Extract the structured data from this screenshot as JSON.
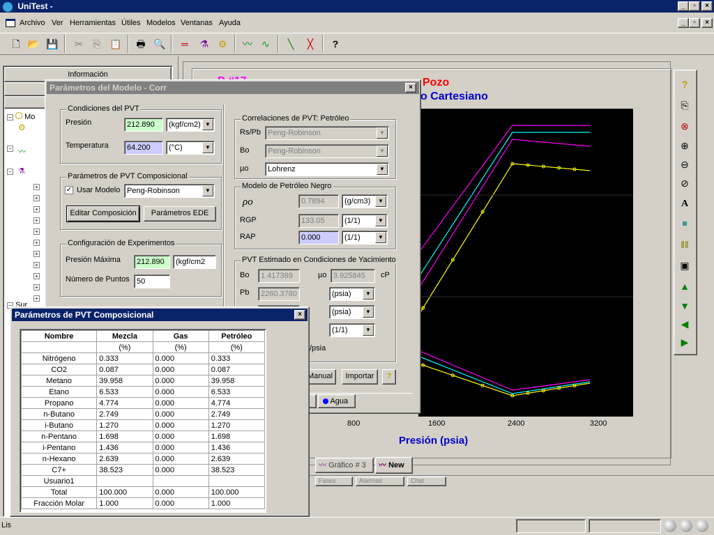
{
  "app": {
    "title": "UniTest -"
  },
  "menu": [
    "Archivo",
    "Ver",
    "Herramientas",
    "Útiles",
    "Modelos",
    "Ventanas",
    "Ayuda"
  ],
  "left_panel": {
    "header": "Información",
    "tree_items": [
      "Mo",
      "Sur"
    ]
  },
  "chart": {
    "title_red": "Pozo",
    "title_red_prefix": "P #17",
    "title_blue": "o Cartesiano",
    "xlabel": "Presión (psia)",
    "tabs": [
      "Gráfico # 3",
      "New"
    ],
    "bottom_tabs": [
      "Fases",
      "Alarmas",
      "Chat"
    ],
    "side_icons": [
      "help-icon",
      "copy-icon",
      "zoom-fit-icon",
      "zoom-in-icon",
      "zoom-out-icon",
      "zoom-reset-icon",
      "text-icon",
      "legend-icon",
      "grid-icon",
      "properties-icon",
      "arrow-up-icon",
      "arrow-down-icon",
      "arrow-left-icon",
      "arrow-right-icon"
    ]
  },
  "chart_data": {
    "type": "line",
    "x_ticks": [
      "800",
      "1600",
      "2400",
      "3200"
    ],
    "xlabel": "Presión (psia)",
    "series": [
      {
        "color": "#ff00ff",
        "points": [
          [
            960,
            470
          ],
          [
            2300,
            180
          ],
          [
            3000,
            180
          ]
        ]
      },
      {
        "color": "#00ffff",
        "points": [
          [
            960,
            520
          ],
          [
            2300,
            190
          ],
          [
            3000,
            190
          ]
        ]
      },
      {
        "color": "#ff00ff",
        "points": [
          [
            960,
            540
          ],
          [
            2300,
            200
          ],
          [
            3000,
            210
          ]
        ]
      },
      {
        "color": "#ffff00",
        "points": [
          [
            960,
            580
          ],
          [
            2300,
            235
          ],
          [
            3000,
            245
          ]
        ]
      }
    ],
    "series_lower": [
      {
        "color": "#ff00ff",
        "points": [
          [
            960,
            470
          ],
          [
            2300,
            560
          ],
          [
            3000,
            545
          ]
        ]
      },
      {
        "color": "#00ffff",
        "points": [
          [
            960,
            480
          ],
          [
            2300,
            565
          ],
          [
            3000,
            548
          ]
        ]
      },
      {
        "color": "#ffff00",
        "points": [
          [
            960,
            495
          ],
          [
            2300,
            568
          ],
          [
            3000,
            550
          ]
        ]
      }
    ],
    "xlim": [
      700,
      3400
    ]
  },
  "dialog_modelo": {
    "title": "Parámetros del Modelo - Corr",
    "condiciones": {
      "title": "Condiciones del PVT",
      "presion_label": "Presión",
      "presion_value": "212.890",
      "presion_unit": "(kgf/cm2)",
      "temperatura_label": "Temperatura",
      "temperatura_value": "64.200",
      "temperatura_unit": "(°C)"
    },
    "composicional": {
      "title": "Parámetros de PVT Composicional",
      "usar_modelo_label": "Usar Modelo",
      "usar_modelo_value": "Peng-Robinson",
      "editar_btn": "Editar Composición",
      "ede_btn": "Parámetros EDE"
    },
    "experimentos": {
      "title": "Configuración de Experimentos",
      "presion_max_label": "Presión Máxima",
      "presion_max_value": "212.890",
      "presion_max_unit": "(kgf/cm2",
      "num_puntos_label": "Número de Puntos",
      "num_puntos_value": "50"
    },
    "correlaciones": {
      "title": "Correlaciones de PVT: Petróleo",
      "rspb_label": "Rs/Pb",
      "rspb_value": "Peng-Robinson",
      "bo_label": "Bo",
      "bo_value": "Peng-Robinson",
      "muo_label": "µo",
      "muo_value": "Lohrenz"
    },
    "petroleo_negro": {
      "title": "Modelo de Petróleo Negro",
      "rho_label": "ρo",
      "rho_value": "0.7894",
      "rho_unit": "(g/cm3)",
      "rgp_label": "RGP",
      "rgp_value": "133.05",
      "rgp_unit": "(1/1)",
      "rap_label": "RAP",
      "rap_value": "0.000",
      "rap_unit": "(1/1)"
    },
    "estimado": {
      "title": "PVT Estimado en Condiciones de Yacimiento",
      "bo_label": "Bo",
      "bo_value": "1.417389",
      "mu_label": "µo",
      "mu_value": "3.925845",
      "mu_unit": "cP",
      "pb_label": "Pb",
      "pb_value": "2260.3780",
      "pb_unit": "(psia)",
      "row2_unit": "(psia)",
      "row3_unit": "(1/1)",
      "row4_fragment": "/psia"
    },
    "buttons": {
      "manual": "Manual",
      "importar": "Importar",
      "help": "?"
    },
    "tabs": {
      "agua": "Agua"
    }
  },
  "dialog_composicional": {
    "title": "Parámetros de PVT Composicional",
    "columns": [
      "Nombre",
      "Mezcla",
      "Gas",
      "Petróleo"
    ],
    "units": [
      "",
      "(%)",
      "(%)",
      "(%)"
    ],
    "rows": [
      [
        "Nitrógeno",
        "0.333",
        "0.000",
        "0.333"
      ],
      [
        "CO2",
        "0.087",
        "0.000",
        "0.087"
      ],
      [
        "Metano",
        "39.958",
        "0.000",
        "39.958"
      ],
      [
        "Etano",
        "6.533",
        "0.000",
        "6.533"
      ],
      [
        "Propano",
        "4.774",
        "0.000",
        "4.774"
      ],
      [
        "n-Butano",
        "2.749",
        "0.000",
        "2.749"
      ],
      [
        "i-Butano",
        "1.270",
        "0.000",
        "1.270"
      ],
      [
        "n-Pentano",
        "1.698",
        "0.000",
        "1.698"
      ],
      [
        "i-Pentano",
        "1.436",
        "0.000",
        "1.436"
      ],
      [
        "n-Hexano",
        "2.639",
        "0.000",
        "2.639"
      ],
      [
        "C7+",
        "38.523",
        "0.000",
        "38.523"
      ],
      [
        "Usuario1",
        "",
        "",
        ""
      ],
      [
        "Total",
        "100.000",
        "0.000",
        "100.000"
      ],
      [
        "Fracción Molar",
        "1.000",
        "0.000",
        "1.000"
      ]
    ]
  },
  "status": {
    "left": "Lis"
  }
}
